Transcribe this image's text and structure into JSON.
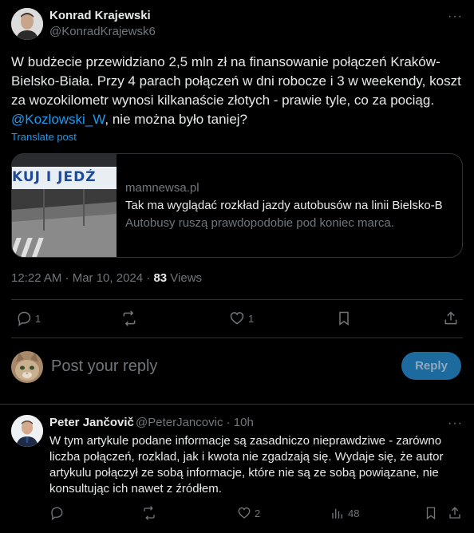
{
  "post": {
    "author_name": "Konrad Krajewski",
    "author_handle": "@KonradKrajewsk6",
    "more_label": "···",
    "text_before": "W budżecie przewidziano 2,5 mln zł na finansowanie połączeń Kraków-Bielsko-Biała. Przy 4 parach połączeń w dni robocze i 3 w weekendy, koszt za wozokilometr wynosi kilkanaście złotych - prawie tyle, co za pociąg. ",
    "mention": "@Kozlowski_W",
    "text_after": ", nie można było taniej?",
    "translate_label": "Translate post",
    "card": {
      "image_caption": "KUJ I JEDŹ",
      "domain": "mamnewsa.pl",
      "title": "Tak ma wyglądać rozkład jazdy autobusów na linii Bielsko-B",
      "description": "Autobusy ruszą prawdopodobie pod koniec marca."
    },
    "timestamp": "12:22 AM · Mar 10, 2024 · ",
    "views_count": "83",
    "views_label": " Views",
    "actions": {
      "replies": "1",
      "reposts": "",
      "likes": "1"
    }
  },
  "reply_box": {
    "placeholder": "Post your reply",
    "button_label": "Reply"
  },
  "reply": {
    "author_name": "Peter Jančovič",
    "author_handle": "@PeterJancovic · 10h",
    "more_label": "···",
    "text": "W tym artykule podane informacje są zasadniczo nieprawdziwe - zarówno liczba połączeń, rozklad, jak i kwota nie zgadzają się. Wydaje się, że autor artykulu połączył ze sobą informacje, które nie są ze sobą powiązane, nie konsultując ich nawet z źródłem.",
    "actions": {
      "replies": "",
      "reposts": "",
      "likes": "2",
      "views": "48"
    }
  },
  "colors": {
    "accent": "#1d9bf0",
    "muted": "#71767b",
    "border": "#2f3336",
    "text": "#e7e9ea"
  }
}
